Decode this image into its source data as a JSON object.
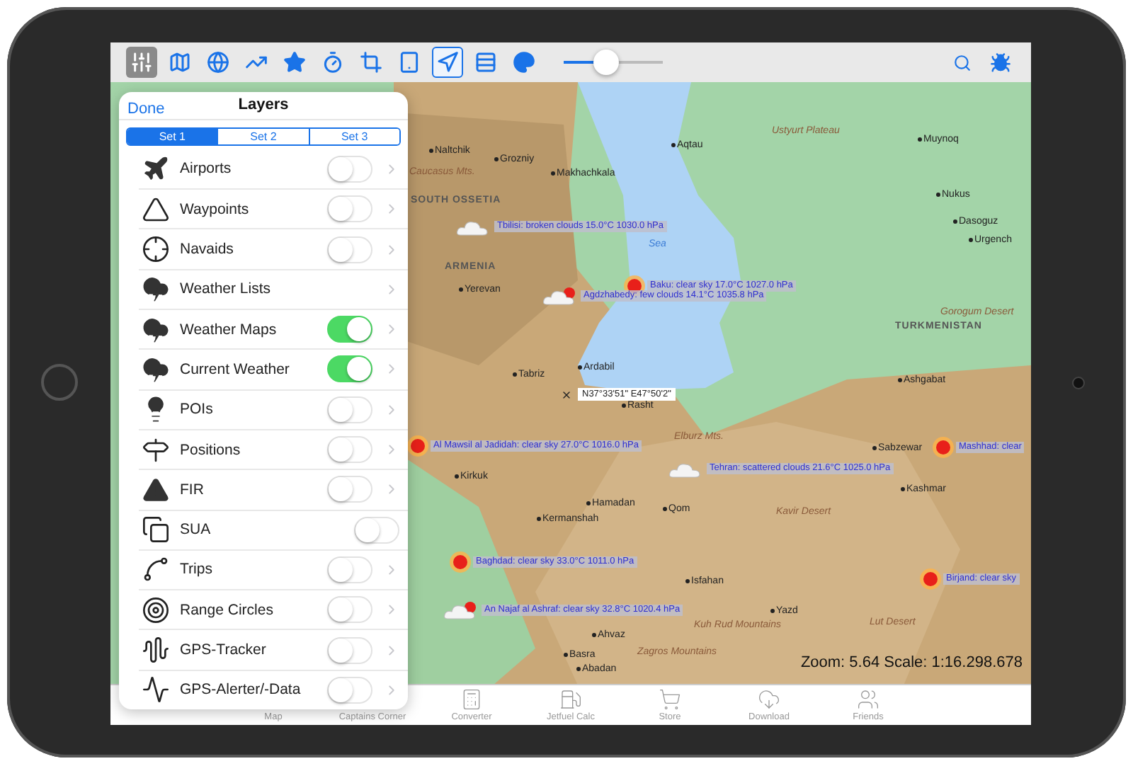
{
  "toolbar": {
    "tools": [
      {
        "selected": true,
        "active": false
      },
      {
        "selected": false,
        "active": false
      },
      {
        "selected": false,
        "active": false
      },
      {
        "selected": false,
        "active": false
      },
      {
        "selected": false,
        "active": false
      },
      {
        "selected": false,
        "active": false
      },
      {
        "selected": false,
        "active": false
      },
      {
        "selected": false,
        "active": false
      },
      {
        "selected": false,
        "active": true
      },
      {
        "selected": false,
        "active": false
      },
      {
        "selected": false,
        "active": false
      }
    ],
    "opacity_slider": {
      "level": 0.43
    }
  },
  "layers_panel": {
    "done": "Done",
    "title": "Layers",
    "sets": [
      {
        "label": "Set 1",
        "selected": true
      },
      {
        "label": "Set 2",
        "selected": false
      },
      {
        "label": "Set 3",
        "selected": false
      }
    ],
    "layers": [
      {
        "label": "Airports",
        "kind": "toggle",
        "on": false
      },
      {
        "label": "Waypoints",
        "kind": "toggle",
        "on": false
      },
      {
        "label": "Navaids",
        "kind": "toggle",
        "on": false
      },
      {
        "label": "Weather Lists",
        "kind": "link"
      },
      {
        "label": "Weather Maps",
        "kind": "toggle",
        "on": true
      },
      {
        "label": "Current Weather",
        "kind": "toggle",
        "on": true
      },
      {
        "label": "POIs",
        "kind": "toggle",
        "on": false
      },
      {
        "label": "Positions",
        "kind": "toggle",
        "on": false
      },
      {
        "label": "FIR",
        "kind": "toggle",
        "on": false
      },
      {
        "label": "SUA",
        "kind": "switch",
        "on": false
      },
      {
        "label": "Trips",
        "kind": "toggle",
        "on": false
      },
      {
        "label": "Range Circles",
        "kind": "toggle",
        "on": false
      },
      {
        "label": "GPS-Tracker",
        "kind": "toggle",
        "on": false
      },
      {
        "label": "GPS-Alerter/-Data",
        "kind": "toggle",
        "on": false
      }
    ]
  },
  "map": {
    "places": [
      {
        "name": "Naltchik",
        "kind": "city"
      },
      {
        "name": "Grozniy",
        "kind": "city"
      },
      {
        "name": "Makhachkala",
        "kind": "city"
      },
      {
        "name": "Aqtau",
        "kind": "city"
      },
      {
        "name": "Ustyurt Plateau",
        "kind": "region"
      },
      {
        "name": "Muynoq",
        "kind": "city"
      },
      {
        "name": "Nukus",
        "kind": "city"
      },
      {
        "name": "Dasoguz",
        "kind": "city"
      },
      {
        "name": "Urgench",
        "kind": "city"
      },
      {
        "name": "Caucasus Mts.",
        "kind": "region"
      },
      {
        "name": "SOUTH OSSETIA",
        "kind": "country"
      },
      {
        "name": "Sea",
        "kind": "water"
      },
      {
        "name": "ARMENIA",
        "kind": "country"
      },
      {
        "name": "Yerevan",
        "kind": "city"
      },
      {
        "name": "Gorogum Desert",
        "kind": "region"
      },
      {
        "name": "TURKMENISTAN",
        "kind": "country"
      },
      {
        "name": "Tabriz",
        "kind": "city"
      },
      {
        "name": "Ardabil",
        "kind": "city"
      },
      {
        "name": "Ashgabat",
        "kind": "city"
      },
      {
        "name": "Rasht",
        "kind": "city"
      },
      {
        "name": "Elburz Mts.",
        "kind": "region"
      },
      {
        "name": "Sabzewar",
        "kind": "city"
      },
      {
        "name": "Kirkuk",
        "kind": "city"
      },
      {
        "name": "Kashmar",
        "kind": "city"
      },
      {
        "name": "Hamadan",
        "kind": "city"
      },
      {
        "name": "Qom",
        "kind": "city"
      },
      {
        "name": "Kermanshah",
        "kind": "city"
      },
      {
        "name": "Kavir Desert",
        "kind": "region"
      },
      {
        "name": "Isfahan",
        "kind": "city"
      },
      {
        "name": "Yazd",
        "kind": "city"
      },
      {
        "name": "Kuh Rud Mountains",
        "kind": "region"
      },
      {
        "name": "Lut Desert",
        "kind": "region"
      },
      {
        "name": "Ahvaz",
        "kind": "city"
      },
      {
        "name": "Basra",
        "kind": "city"
      },
      {
        "name": "Zagros Mountains",
        "kind": "region"
      },
      {
        "name": "Abadan",
        "kind": "city"
      }
    ],
    "weather": [
      {
        "kind": "cloud",
        "text": "Tbilisi: broken clouds 15.0°C 1030.0 hPa"
      },
      {
        "kind": "sun",
        "text": "Baku: clear sky 17.0°C 1027.0 hPa"
      },
      {
        "kind": "cloud_sun",
        "text": "Agdzhabedy: few clouds 14.1°C 1035.8 hPa"
      },
      {
        "kind": "sun",
        "text": "Al Mawsil al Jadidah: clear sky 27.0°C 1016.0 hPa"
      },
      {
        "kind": "cloud",
        "text": "Tehran: scattered clouds 21.6°C 1025.0 hPa"
      },
      {
        "kind": "sun",
        "text": "Mashhad: clear"
      },
      {
        "kind": "sun",
        "text": "Baghdad: clear sky 33.0°C 1011.0 hPa"
      },
      {
        "kind": "sun",
        "text": "Birjand: clear sky"
      },
      {
        "kind": "cloud_sun",
        "text": "An Najaf al Ashraf: clear sky 32.8°C 1020.4 hPa"
      }
    ],
    "position": "N37°33'51\"  E47°50'2\"",
    "zoom_scale": "Zoom: 5.64  Scale: 1:16.298.678"
  },
  "tab_bar": [
    {
      "label": "Map"
    },
    {
      "label": "Captains Corner"
    },
    {
      "label": "Converter"
    },
    {
      "label": "Jetfuel Calc"
    },
    {
      "label": "Store"
    },
    {
      "label": "Download"
    },
    {
      "label": "Friends"
    }
  ]
}
